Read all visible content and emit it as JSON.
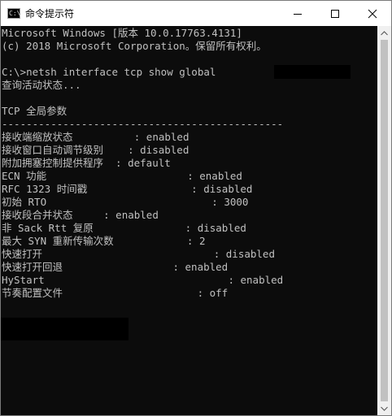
{
  "window": {
    "title": "命令提示符",
    "icon_text": "C:\\"
  },
  "console": {
    "lines": [
      "Microsoft Windows [版本 10.0.17763.4131]",
      "(c) 2018 Microsoft Corporation。保留所有权利。",
      "",
      "C:\\>netsh interface tcp show global",
      "查询活动状态...",
      "",
      "TCP 全局参数",
      "----------------------------------------------",
      "接收端缩放状态          : enabled",
      "接收窗口自动调节级别    : disabled",
      "附加拥塞控制提供程序  : default",
      "ECN 功能                       : enabled",
      "RFC 1323 时间戳                 : disabled",
      "初始 RTO                           : 3000",
      "接收段合并状态     : enabled",
      "非 Sack Rtt 复原               : disabled",
      "最大 SYN 重新传输次数            : 2",
      "快速打开                            : disabled",
      "快速打开回退                  : enabled",
      "HyStart                              : enabled",
      "节奏配置文件                      : off"
    ]
  },
  "colors": {
    "console_bg": "#0c0c0c",
    "console_text": "#c0c0c0",
    "titlebar_bg": "#ffffff",
    "scrollbar_bg": "#f0f0f0",
    "scrollbar_thumb": "#c1c1c1"
  },
  "icons": {
    "minimize": "minimize-icon",
    "maximize": "maximize-icon",
    "close": "close-icon",
    "scroll_up": "chevron-up-icon",
    "scroll_down": "chevron-down-icon"
  }
}
